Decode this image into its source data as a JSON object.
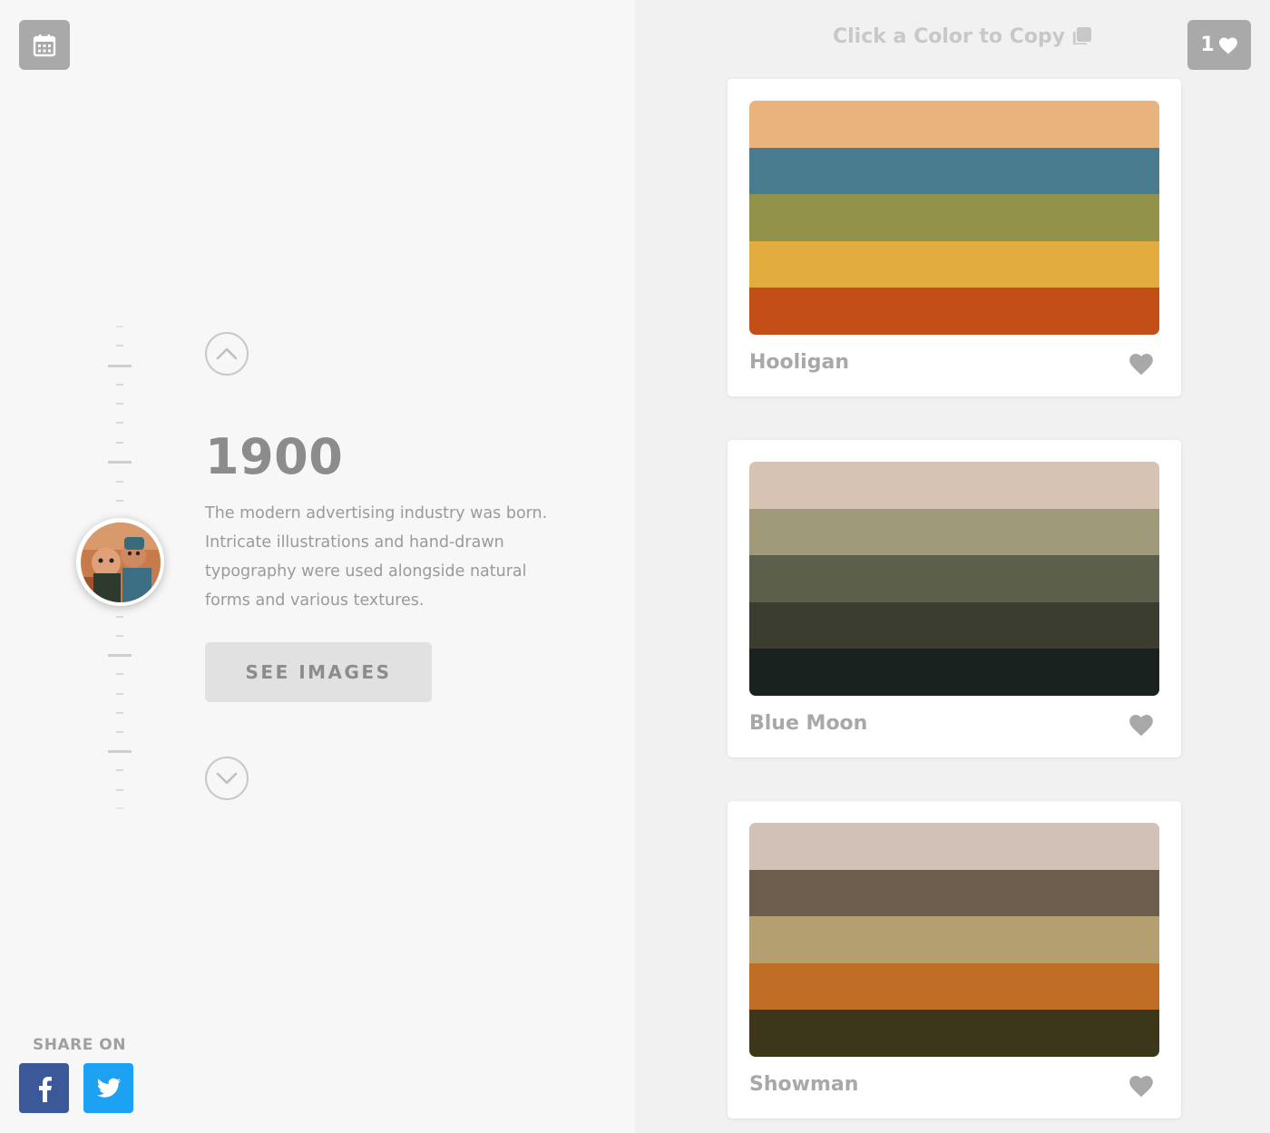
{
  "header": {
    "copy_hint": "Click a Color to Copy",
    "favorites_count": "1"
  },
  "era": {
    "year": "1900",
    "description": "The modern advertising industry was born. Intricate illustrations and hand-drawn typography were used alongside natural forms and various textures.",
    "see_images_label": "SEE IMAGES"
  },
  "share": {
    "label": "SHARE ON"
  },
  "palettes": [
    {
      "name": "Hooligan",
      "colors": [
        "#EAB37E",
        "#4A7C90",
        "#93924A",
        "#E2AD3E",
        "#C34E18"
      ]
    },
    {
      "name": "Blue Moon",
      "colors": [
        "#D6C3B4",
        "#9F9A7A",
        "#5C604A",
        "#3A3D30",
        "#1A2220"
      ]
    },
    {
      "name": "Showman",
      "colors": [
        "#D1C1B7",
        "#6D5D4D",
        "#B39F6F",
        "#C06E25",
        "#3C361B"
      ]
    }
  ],
  "icons": {
    "calendar": "calendar-icon",
    "copy": "copy-icon",
    "heart": "heart-icon",
    "facebook": "facebook-icon",
    "twitter": "twitter-icon",
    "chevron_up": "chevron-up-icon",
    "chevron_down": "chevron-down-icon"
  },
  "colors": {
    "facebook": "#3b5998",
    "twitter": "#1da1f2",
    "button_gray": "#a9a9a9"
  }
}
